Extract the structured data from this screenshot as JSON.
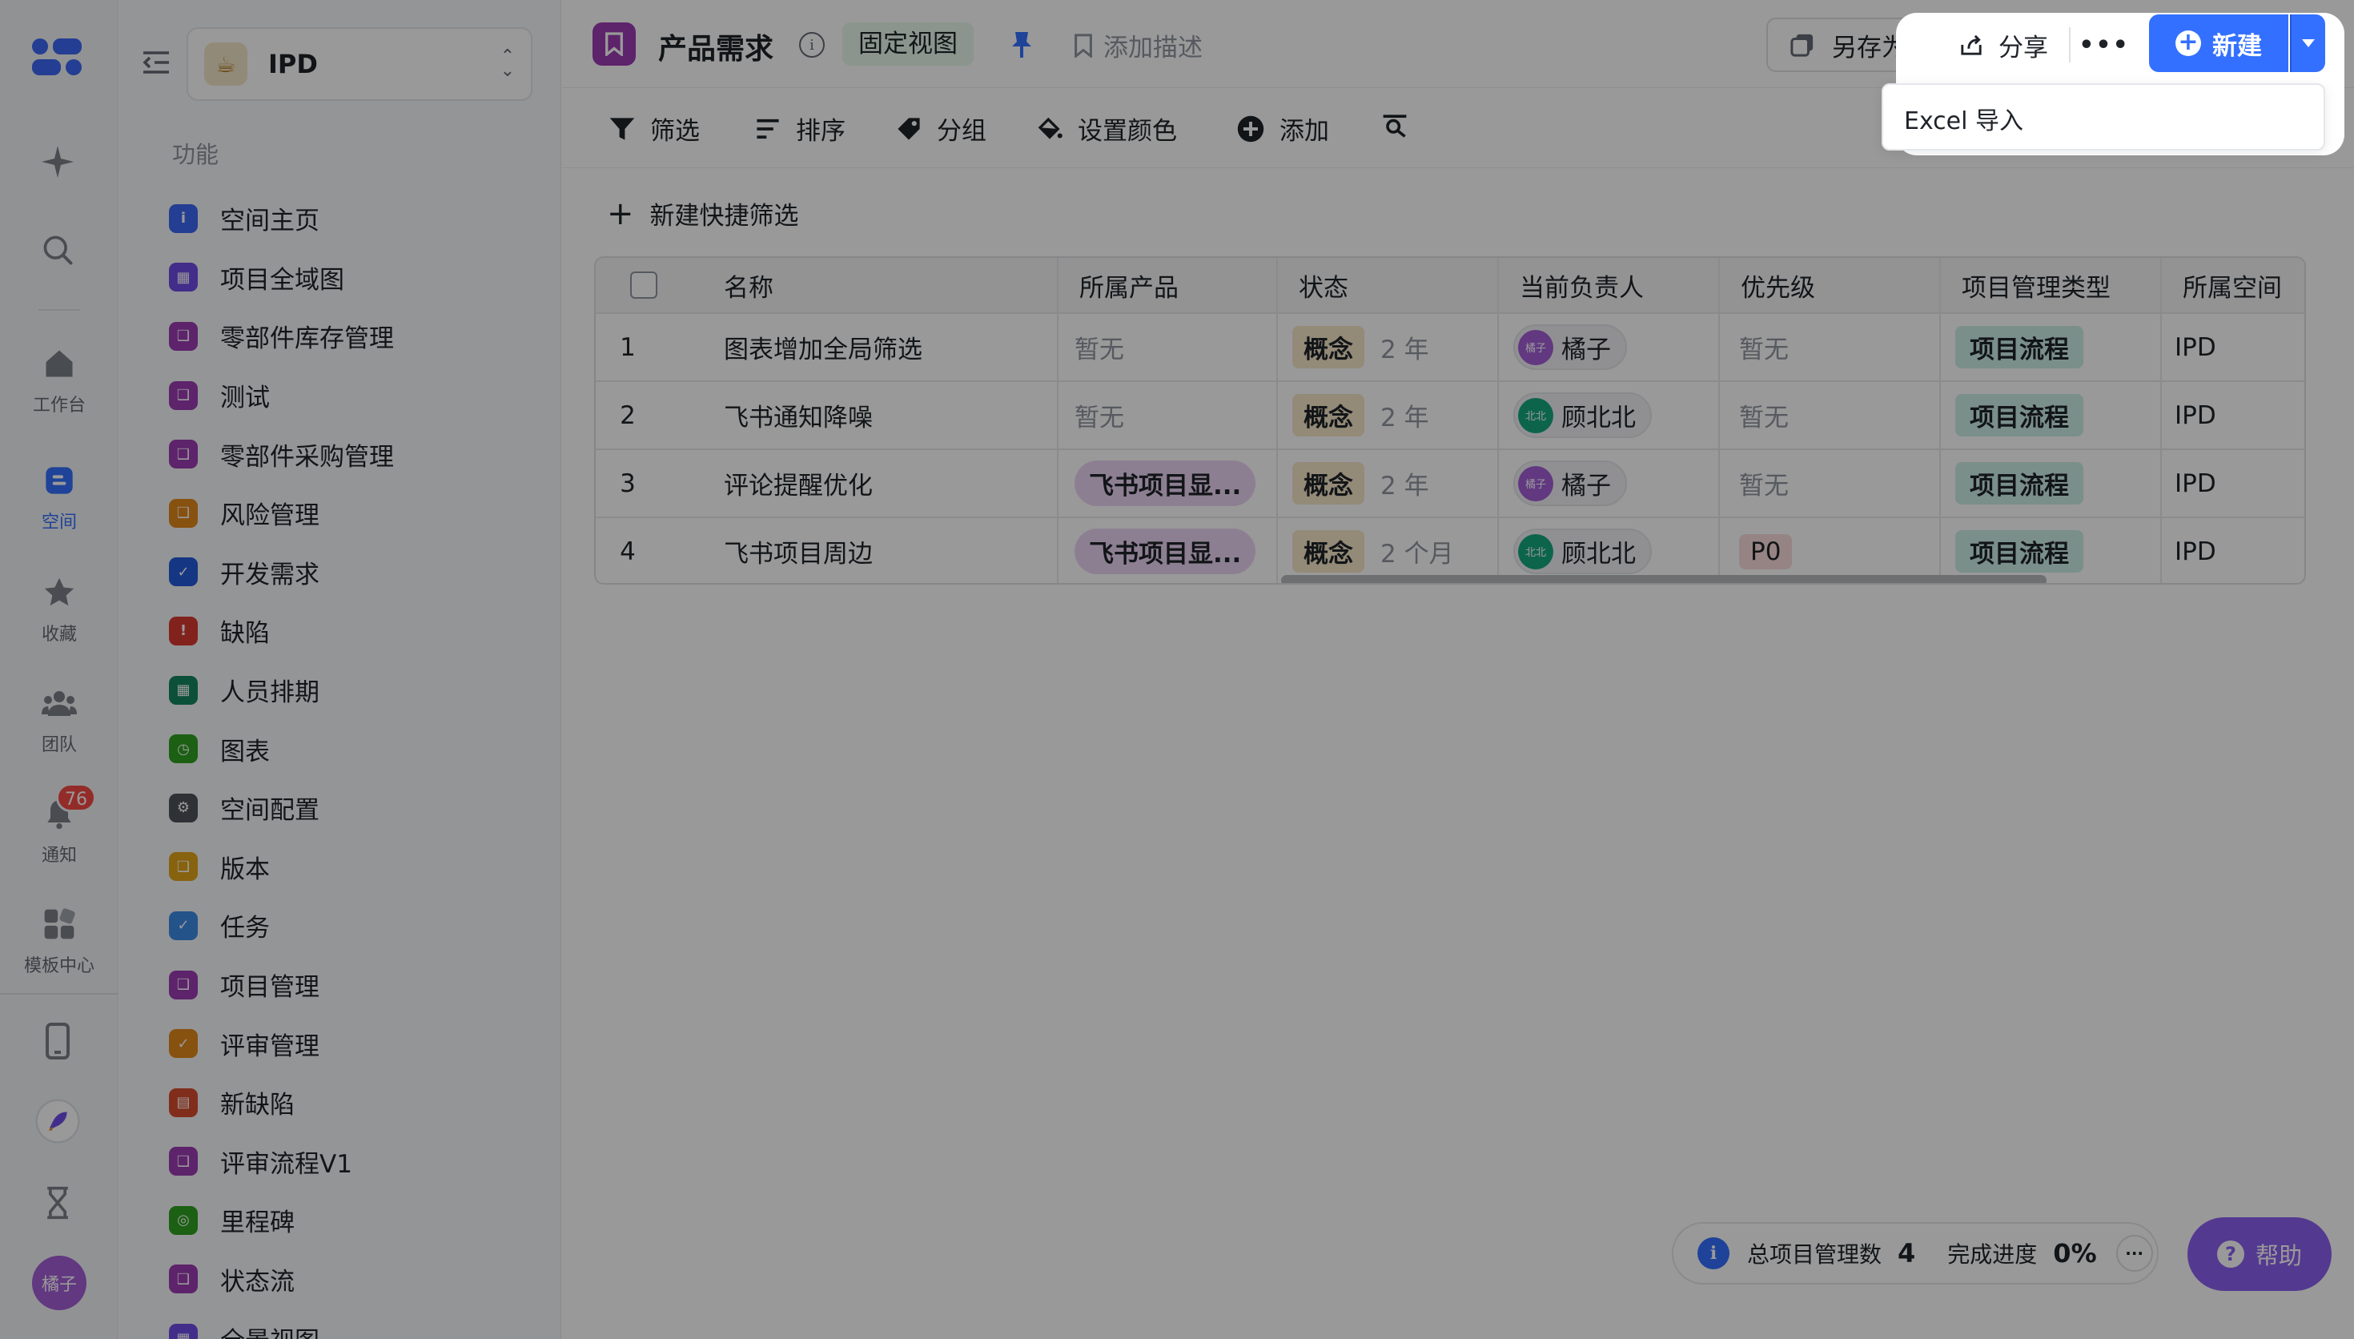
{
  "rail": {
    "items": [
      {
        "label": "工作台"
      },
      {
        "label": "空间"
      },
      {
        "label": "收藏"
      },
      {
        "label": "团队"
      },
      {
        "label": "通知"
      },
      {
        "label": "模板中心"
      }
    ],
    "notification_count": "76",
    "avatar_text": "橘子",
    "accent": "#3370ff"
  },
  "sidebar": {
    "space_name": "IPD",
    "section_title": "功能",
    "items": [
      {
        "label": "空间主页",
        "color": "#3d68f5",
        "icon": "info-icon"
      },
      {
        "label": "项目全域图",
        "color": "#6e4ee6",
        "icon": "grid-icon"
      },
      {
        "label": "零部件库存管理",
        "color": "#9c3bb3",
        "icon": "bookmark-icon"
      },
      {
        "label": "测试",
        "color": "#9c3bb3",
        "icon": "bookmark-icon"
      },
      {
        "label": "零部件采购管理",
        "color": "#9c3bb3",
        "icon": "bookmark-icon"
      },
      {
        "label": "风险管理",
        "color": "#e2871a",
        "icon": "bookmark-icon"
      },
      {
        "label": "开发需求",
        "color": "#245bdb",
        "icon": "check-icon"
      },
      {
        "label": "缺陷",
        "color": "#d83931",
        "icon": "alert-icon"
      },
      {
        "label": "人员排期",
        "color": "#15865f",
        "icon": "grid-icon"
      },
      {
        "label": "图表",
        "color": "#2ea121",
        "icon": "clock-icon"
      },
      {
        "label": "空间配置",
        "color": "#4e5359",
        "icon": "gear-icon"
      },
      {
        "label": "版本",
        "color": "#e2a31a",
        "icon": "bookmark-icon"
      },
      {
        "label": "任务",
        "color": "#3c8ae5",
        "icon": "check-icon"
      },
      {
        "label": "项目管理",
        "color": "#9c3bb3",
        "icon": "bookmark-icon"
      },
      {
        "label": "评审管理",
        "color": "#e2871a",
        "icon": "check-icon"
      },
      {
        "label": "新缺陷",
        "color": "#d84b2e",
        "icon": "book-icon"
      },
      {
        "label": "评审流程V1",
        "color": "#9c3bb3",
        "icon": "bookmark-icon"
      },
      {
        "label": "里程碑",
        "color": "#2ea121",
        "icon": "target-icon"
      },
      {
        "label": "状态流",
        "color": "#9c3bb3",
        "icon": "bookmark-icon"
      },
      {
        "label": "全景视图",
        "color": "#6e4ee6",
        "icon": "grid-icon"
      }
    ]
  },
  "header": {
    "title": "产品需求",
    "fixed_view": "固定视图",
    "add_description": "添加描述",
    "save_as": "另存为",
    "share": "分享",
    "new": "新建",
    "dropdown_items": [
      "Excel 导入"
    ]
  },
  "toolbar": {
    "filter": "筛选",
    "sort": "排序",
    "group": "分组",
    "set_color": "设置颜色",
    "add": "添加"
  },
  "quick_filter": "新建快捷筛选",
  "table": {
    "columns": [
      "名称",
      "所属产品",
      "状态",
      "当前负责人",
      "优先级",
      "项目管理类型",
      "所属空间"
    ],
    "rows": [
      {
        "no": "1",
        "name": "图表增加全局筛选",
        "product": "暂无",
        "status": "概念",
        "duration": "2 年",
        "owner": "橘子",
        "owner_avatar": "橘子",
        "owner_color": "#a45ed8",
        "priority": "暂无",
        "type": "项目流程",
        "space": "IPD"
      },
      {
        "no": "2",
        "name": "飞书通知降噪",
        "product": "暂无",
        "status": "概念",
        "duration": "2 年",
        "owner": "顾北北",
        "owner_avatar": "北北",
        "owner_color": "#14a77e",
        "priority": "暂无",
        "type": "项目流程",
        "space": "IPD"
      },
      {
        "no": "3",
        "name": "评论提醒优化",
        "product": "飞书项目显...",
        "status": "概念",
        "duration": "2 年",
        "owner": "橘子",
        "owner_avatar": "橘子",
        "owner_color": "#a45ed8",
        "priority": "暂无",
        "type": "项目流程",
        "space": "IPD"
      },
      {
        "no": "4",
        "name": "飞书项目周边",
        "product": "飞书项目显...",
        "status": "概念",
        "duration": "2 个月",
        "owner": "顾北北",
        "owner_avatar": "北北",
        "owner_color": "#14a77e",
        "priority": "P0",
        "type": "项目流程",
        "space": "IPD"
      }
    ]
  },
  "stats": {
    "total_label": "总项目管理数",
    "total_value": "4",
    "progress_label": "完成进度",
    "progress_value": "0%"
  },
  "help": "帮助"
}
